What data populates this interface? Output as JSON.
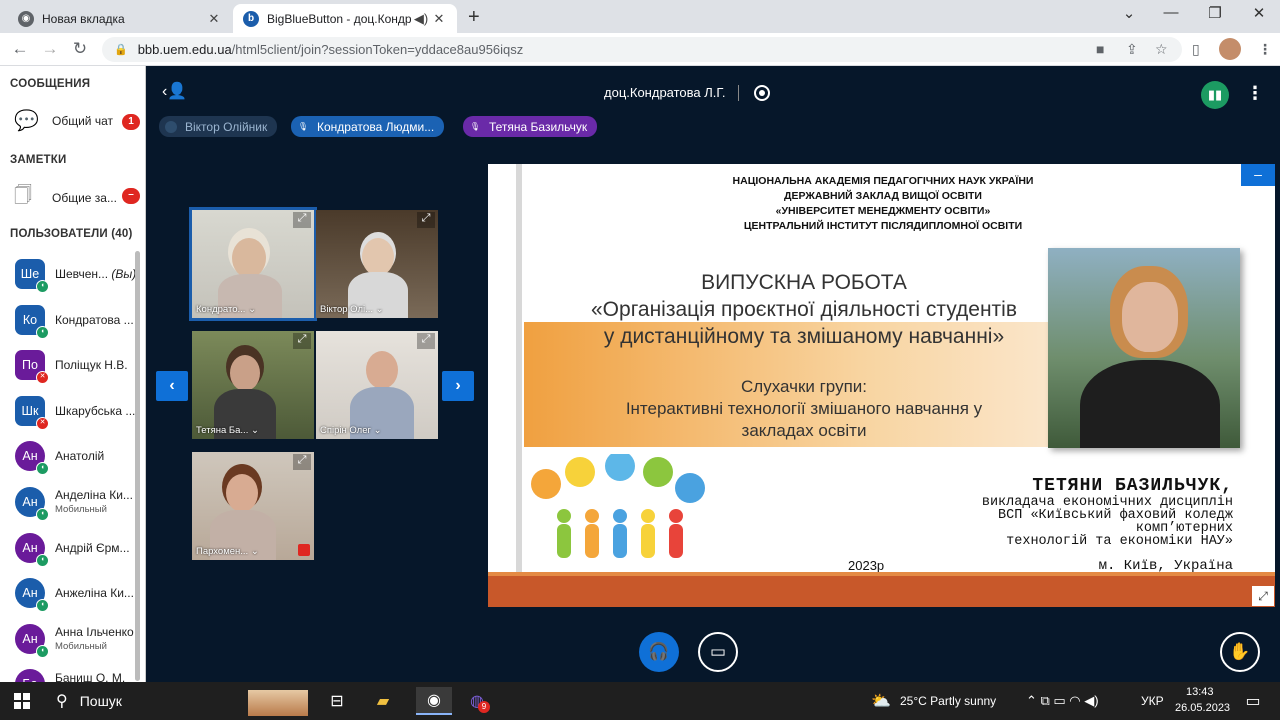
{
  "browser": {
    "tabs": [
      {
        "title": "Новая вкладка"
      },
      {
        "title": "BigBlueButton - доц.Кондрат"
      }
    ],
    "url_domain": "bbb.uem.edu.ua",
    "url_path": "/html5client/join?sessionToken=yddace8au956iqsz"
  },
  "sidebar": {
    "messages_title": "СООБЩЕНИЯ",
    "public_chat": "Общий чат",
    "chat_badge": "1",
    "notes_title": "ЗАМЕТКИ",
    "shared_notes": "Общие за...",
    "users_title": "ПОЛЬЗОВАТЕЛИ (40)",
    "users": [
      {
        "initials": "Ше",
        "name": "Шевчен...",
        "you": "(Вы)",
        "sub": "",
        "color": "#1b5dab"
      },
      {
        "initials": "Ко",
        "name": "Кондратова ...",
        "you": "",
        "sub": "",
        "color": "#1b5dab"
      },
      {
        "initials": "По",
        "name": "Поліщук Н.В.",
        "you": "",
        "sub": "",
        "color": "#6a1b9a"
      },
      {
        "initials": "Шк",
        "name": "Шкарубська ...",
        "you": "",
        "sub": "",
        "color": "#1b5dab"
      },
      {
        "initials": "Ан",
        "name": "Анатолій",
        "you": "",
        "sub": "",
        "color": "#6a1b9a"
      },
      {
        "initials": "Ан",
        "name": "Анделіна Ки...",
        "you": "",
        "sub": "Мобильный",
        "color": "#1b5dab"
      },
      {
        "initials": "Ан",
        "name": "Андрій Єрм...",
        "you": "",
        "sub": "",
        "color": "#6a1b9a"
      },
      {
        "initials": "Ан",
        "name": "Анжеліна Ки...",
        "you": "",
        "sub": "",
        "color": "#1b5dab"
      },
      {
        "initials": "Ан",
        "name": "Анна Ільченко",
        "you": "",
        "sub": "Мобильный",
        "color": "#6a1b9a"
      },
      {
        "initials": "Ба",
        "name": "Баниш О. М.",
        "you": "",
        "sub": "",
        "color": "#6a1b9a"
      }
    ]
  },
  "meeting": {
    "title": "доц.Кондратова Л.Г.",
    "talkers": [
      {
        "name": "Віктор Олійник",
        "bg": "#1e3550",
        "color": "#9bb5d0"
      },
      {
        "name": "Кондратова Людми...",
        "bg": "#1b62b3",
        "color": "#ffffff"
      },
      {
        "name": "Тетяна Базильчук",
        "bg": "#6a2aa8",
        "color": "#ffffff"
      }
    ],
    "videos": [
      {
        "label": "Кондрато...",
        "arrow": "⌄"
      },
      {
        "label": "Віктор Олі...",
        "arrow": "⌄"
      },
      {
        "label": "Тетяна Ба...",
        "arrow": "⌄"
      },
      {
        "label": "Спірін Олег",
        "arrow": "⌄"
      },
      {
        "label": "Пархомен...",
        "arrow": "⌄"
      }
    ]
  },
  "slide": {
    "header": [
      "НАЦІОНАЛЬНА АКАДЕМІЯ ПЕДАГОГІЧНИХ НАУК УКРАЇНИ",
      "ДЕРЖАВНИЙ ЗАКЛАД ВИЩОЇ ОСВІТИ",
      "«УНІВЕРСИТЕТ МЕНЕДЖМЕНТУ ОСВІТИ»",
      "ЦЕНТРАЛЬНИЙ ІНСТИТУТ ПІСЛЯДИПЛОМНОЇ ОСВІТИ"
    ],
    "title_lines": [
      "ВИПУСКНА РОБОТА",
      "«Організація проєктної діяльності студентів",
      "у дистанційному та змішаному навчанні»"
    ],
    "group_lines": [
      "Слухачки групи:",
      "Інтерактивні технології змішаного навчання у",
      "закладах освіти"
    ],
    "author_name": "ТЕТЯНИ БАЗИЛЬЧУК,",
    "author_desc": [
      "викладача економічних дисциплін",
      "ВСП «Київський фаховий коледж",
      "комп’ютерних",
      "технологій та економіки НАУ»"
    ],
    "year": "2023р",
    "city": "м. Київ, Україна"
  },
  "taskbar": {
    "search": "Пошук",
    "weather": "25°C  Partly sunny",
    "lang": "УКР",
    "time": "13:43",
    "date": "26.05.2023",
    "viber_badge": "9"
  }
}
